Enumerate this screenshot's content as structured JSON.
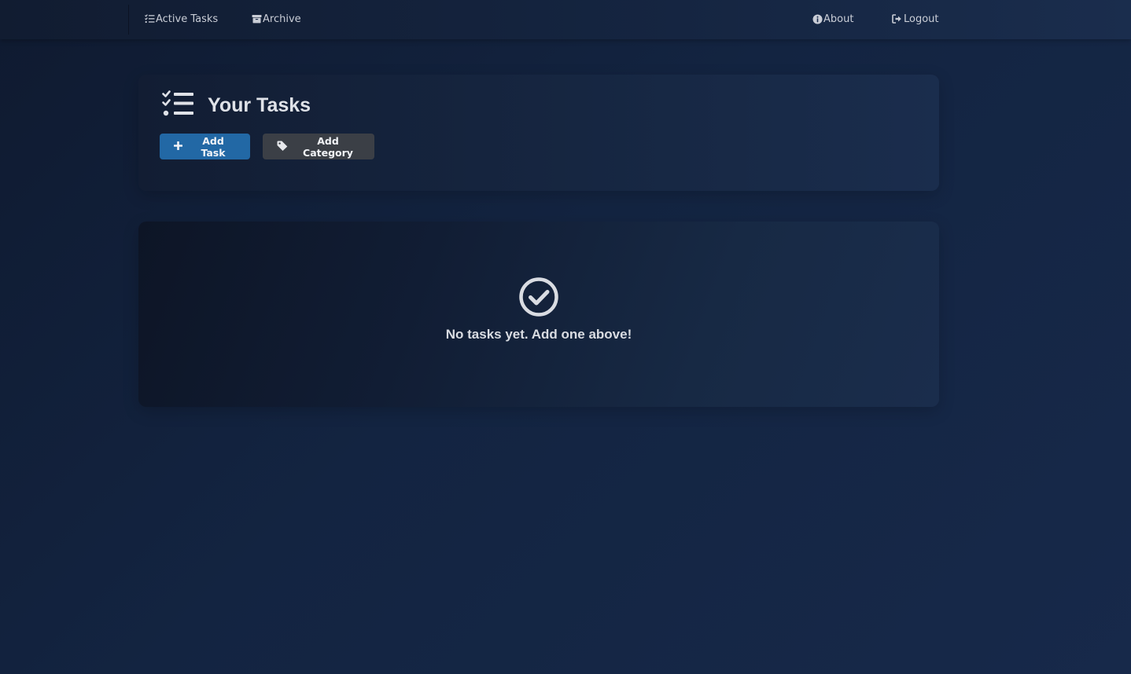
{
  "nav": {
    "active_tasks": "Active Tasks",
    "archive": "Archive",
    "about": "About",
    "logout": "Logout"
  },
  "header": {
    "title": "Your Tasks",
    "add_task_label": "Add Task",
    "add_category_label": "Add Category"
  },
  "empty_state": {
    "message": "No tasks yet. Add one above!"
  },
  "icons": {
    "active_tasks": "list-check-icon",
    "archive": "archive-box-icon",
    "about": "info-circle-icon",
    "logout": "logout-icon",
    "title": "list-check-icon",
    "add_task": "plus-icon",
    "add_category": "tag-icon",
    "empty": "check-circle-icon"
  },
  "colors": {
    "primary_button": "#2268a5",
    "secondary_button": "#3b3f46",
    "background": "#132441"
  }
}
